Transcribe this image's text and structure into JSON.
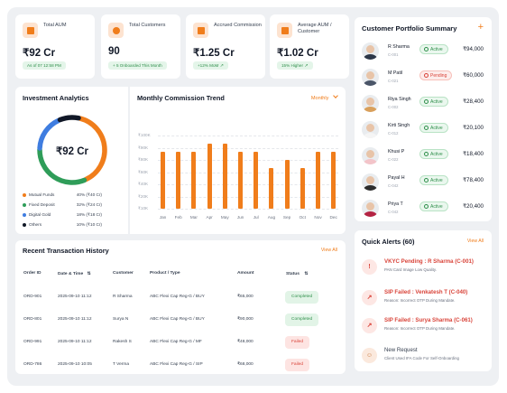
{
  "stats": [
    {
      "title": "Total AUM",
      "value": "₹92 Cr",
      "chip": "As of 07 12:58 PM",
      "arrow": false
    },
    {
      "title": "Total Customers",
      "value": "90",
      "chip": "+ 5 Onboarded This Month",
      "arrow": false
    },
    {
      "title": "Accrued Commission",
      "value": "₹1.25 Cr",
      "chip": "+12% MoM",
      "arrow": true
    },
    {
      "title": "Average AUM / Customer",
      "value": "₹1.02 Cr",
      "chip": "15% Higher",
      "arrow": true
    }
  ],
  "analytics": {
    "title": "Investment Analytics",
    "center_value": "₹92 Cr",
    "colors": {
      "mutual_funds": "#f07d1b",
      "fixed_deposit": "#2f9d59",
      "digital_gold": "#3f7de0",
      "others": "#111827"
    },
    "legend": [
      {
        "name": "Mutual Funds",
        "value": "40% (₹40 Cr)",
        "color": "#f07d1b",
        "share": 0.4
      },
      {
        "name": "Fixed Deposit",
        "value": "32% (₹24 Cr)",
        "color": "#2f9d59",
        "share": 0.32
      },
      {
        "name": "Digital Gold",
        "value": "18% (₹18 Cr)",
        "color": "#3f7de0",
        "share": 0.18
      },
      {
        "name": "Others",
        "value": "10% (₹10 Cr)",
        "color": "#111827",
        "share": 0.1
      }
    ]
  },
  "commission": {
    "title": "Monthly Commission Trend",
    "period": "Monthly",
    "chevron_icon": "chevron-down-icon"
  },
  "chart_data": {
    "type": "bar",
    "title": "Monthly Commission Trend",
    "categories": [
      "Jan",
      "Feb",
      "Mar",
      "Apr",
      "May",
      "Jun",
      "Jul",
      "Aug",
      "Sep",
      "Oct",
      "Nov",
      "Dec"
    ],
    "values": [
      80,
      80,
      80,
      90,
      90,
      80,
      80,
      60,
      70,
      60,
      80,
      80
    ],
    "y_ticks": [
      "₹100K",
      "₹90K",
      "₹80K",
      "₹60K",
      "₹40K",
      "₹20K",
      "₹10K"
    ],
    "ylim": [
      10,
      100
    ],
    "xlabel": "",
    "ylabel": "",
    "color": "#f07d1b",
    "grid": true
  },
  "transactions": {
    "title": "Recent Transaction History",
    "view_all": "View All",
    "columns": [
      "Order ID",
      "Date & Time",
      "Customer",
      "Product / Type",
      "Amount",
      "Status"
    ],
    "rows": [
      {
        "id": "ORD-901",
        "date": "2025-09-10 11:12",
        "customer": "R Sharma",
        "product": "ABC Flexi Cap Reg-G / BUY",
        "amount": "₹65,000",
        "status": "Completed",
        "kind": "completed"
      },
      {
        "id": "ORD-801",
        "date": "2025-09-10 11:12",
        "customer": "Surya N",
        "product": "ABC Flexi Cap Reg-G / BUY",
        "amount": "₹90,000",
        "status": "Completed",
        "kind": "completed"
      },
      {
        "id": "ORD-991",
        "date": "2025-09-10 11:12",
        "customer": "Rakesh S",
        "product": "ABC Flexi Cap Reg-G / MF",
        "amount": "₹48,000",
        "status": "Failed",
        "kind": "failed"
      },
      {
        "id": "ORD-786",
        "date": "2025-09-10 10:05",
        "customer": "T Verma",
        "product": "ABC Flexi Cap Reg-G / SIP",
        "amount": "₹68,000",
        "status": "Failed",
        "kind": "failed"
      }
    ]
  },
  "portfolio": {
    "title": "Customer Portfolio Summary",
    "add_icon": "plus-icon",
    "customers": [
      {
        "name": "R Sharma",
        "id": "C-001",
        "status": "Active",
        "kind": "active",
        "amount": "₹94,000",
        "shirt": "#2d3748"
      },
      {
        "name": "M Patil",
        "id": "C-021",
        "status": "Pending",
        "kind": "pending",
        "amount": "₹60,000",
        "shirt": "#4a5568"
      },
      {
        "name": "Riya Singh",
        "id": "C-002",
        "status": "Active",
        "kind": "active",
        "amount": "₹28,400",
        "shirt": "#d9a05b"
      },
      {
        "name": "Kirti Singh",
        "id": "C-012",
        "status": "Active",
        "kind": "active",
        "amount": "₹20,100",
        "shirt": "#f5f5f5"
      },
      {
        "name": "Khusi P",
        "id": "C-022",
        "status": "Active",
        "kind": "active",
        "amount": "₹18,400",
        "shirt": "#f3c4c9"
      },
      {
        "name": "Payal H",
        "id": "C-042",
        "status": "Active",
        "kind": "active",
        "amount": "₹78,400",
        "shirt": "#2d2d2d"
      },
      {
        "name": "Priya T",
        "id": "C-042",
        "status": "Active",
        "kind": "active",
        "amount": "₹20,400",
        "shirt": "#b42343"
      }
    ]
  },
  "alerts": {
    "title": "Quick Alerts (60)",
    "view_all": "View All",
    "items": [
      {
        "title": "VKYC Pending : R Sharma (C-001)",
        "sub": "PAN Card Image Low Quality.",
        "icon": "!",
        "kind": "error"
      },
      {
        "title": "SIP Failed : Venkatesh T (C-040)",
        "sub": "Reason: Incorrect OTP During Mandate.",
        "icon": "↗",
        "kind": "error"
      },
      {
        "title": "SIP Failed : Surya Sharma (C-061)",
        "sub": "Reason: Incorrect OTP During Mandate.",
        "icon": "↗",
        "kind": "error"
      },
      {
        "title": "New Request",
        "sub": "Client Used IFA Code For Self-Onboarding",
        "icon": "☺",
        "kind": "neutral"
      }
    ]
  }
}
